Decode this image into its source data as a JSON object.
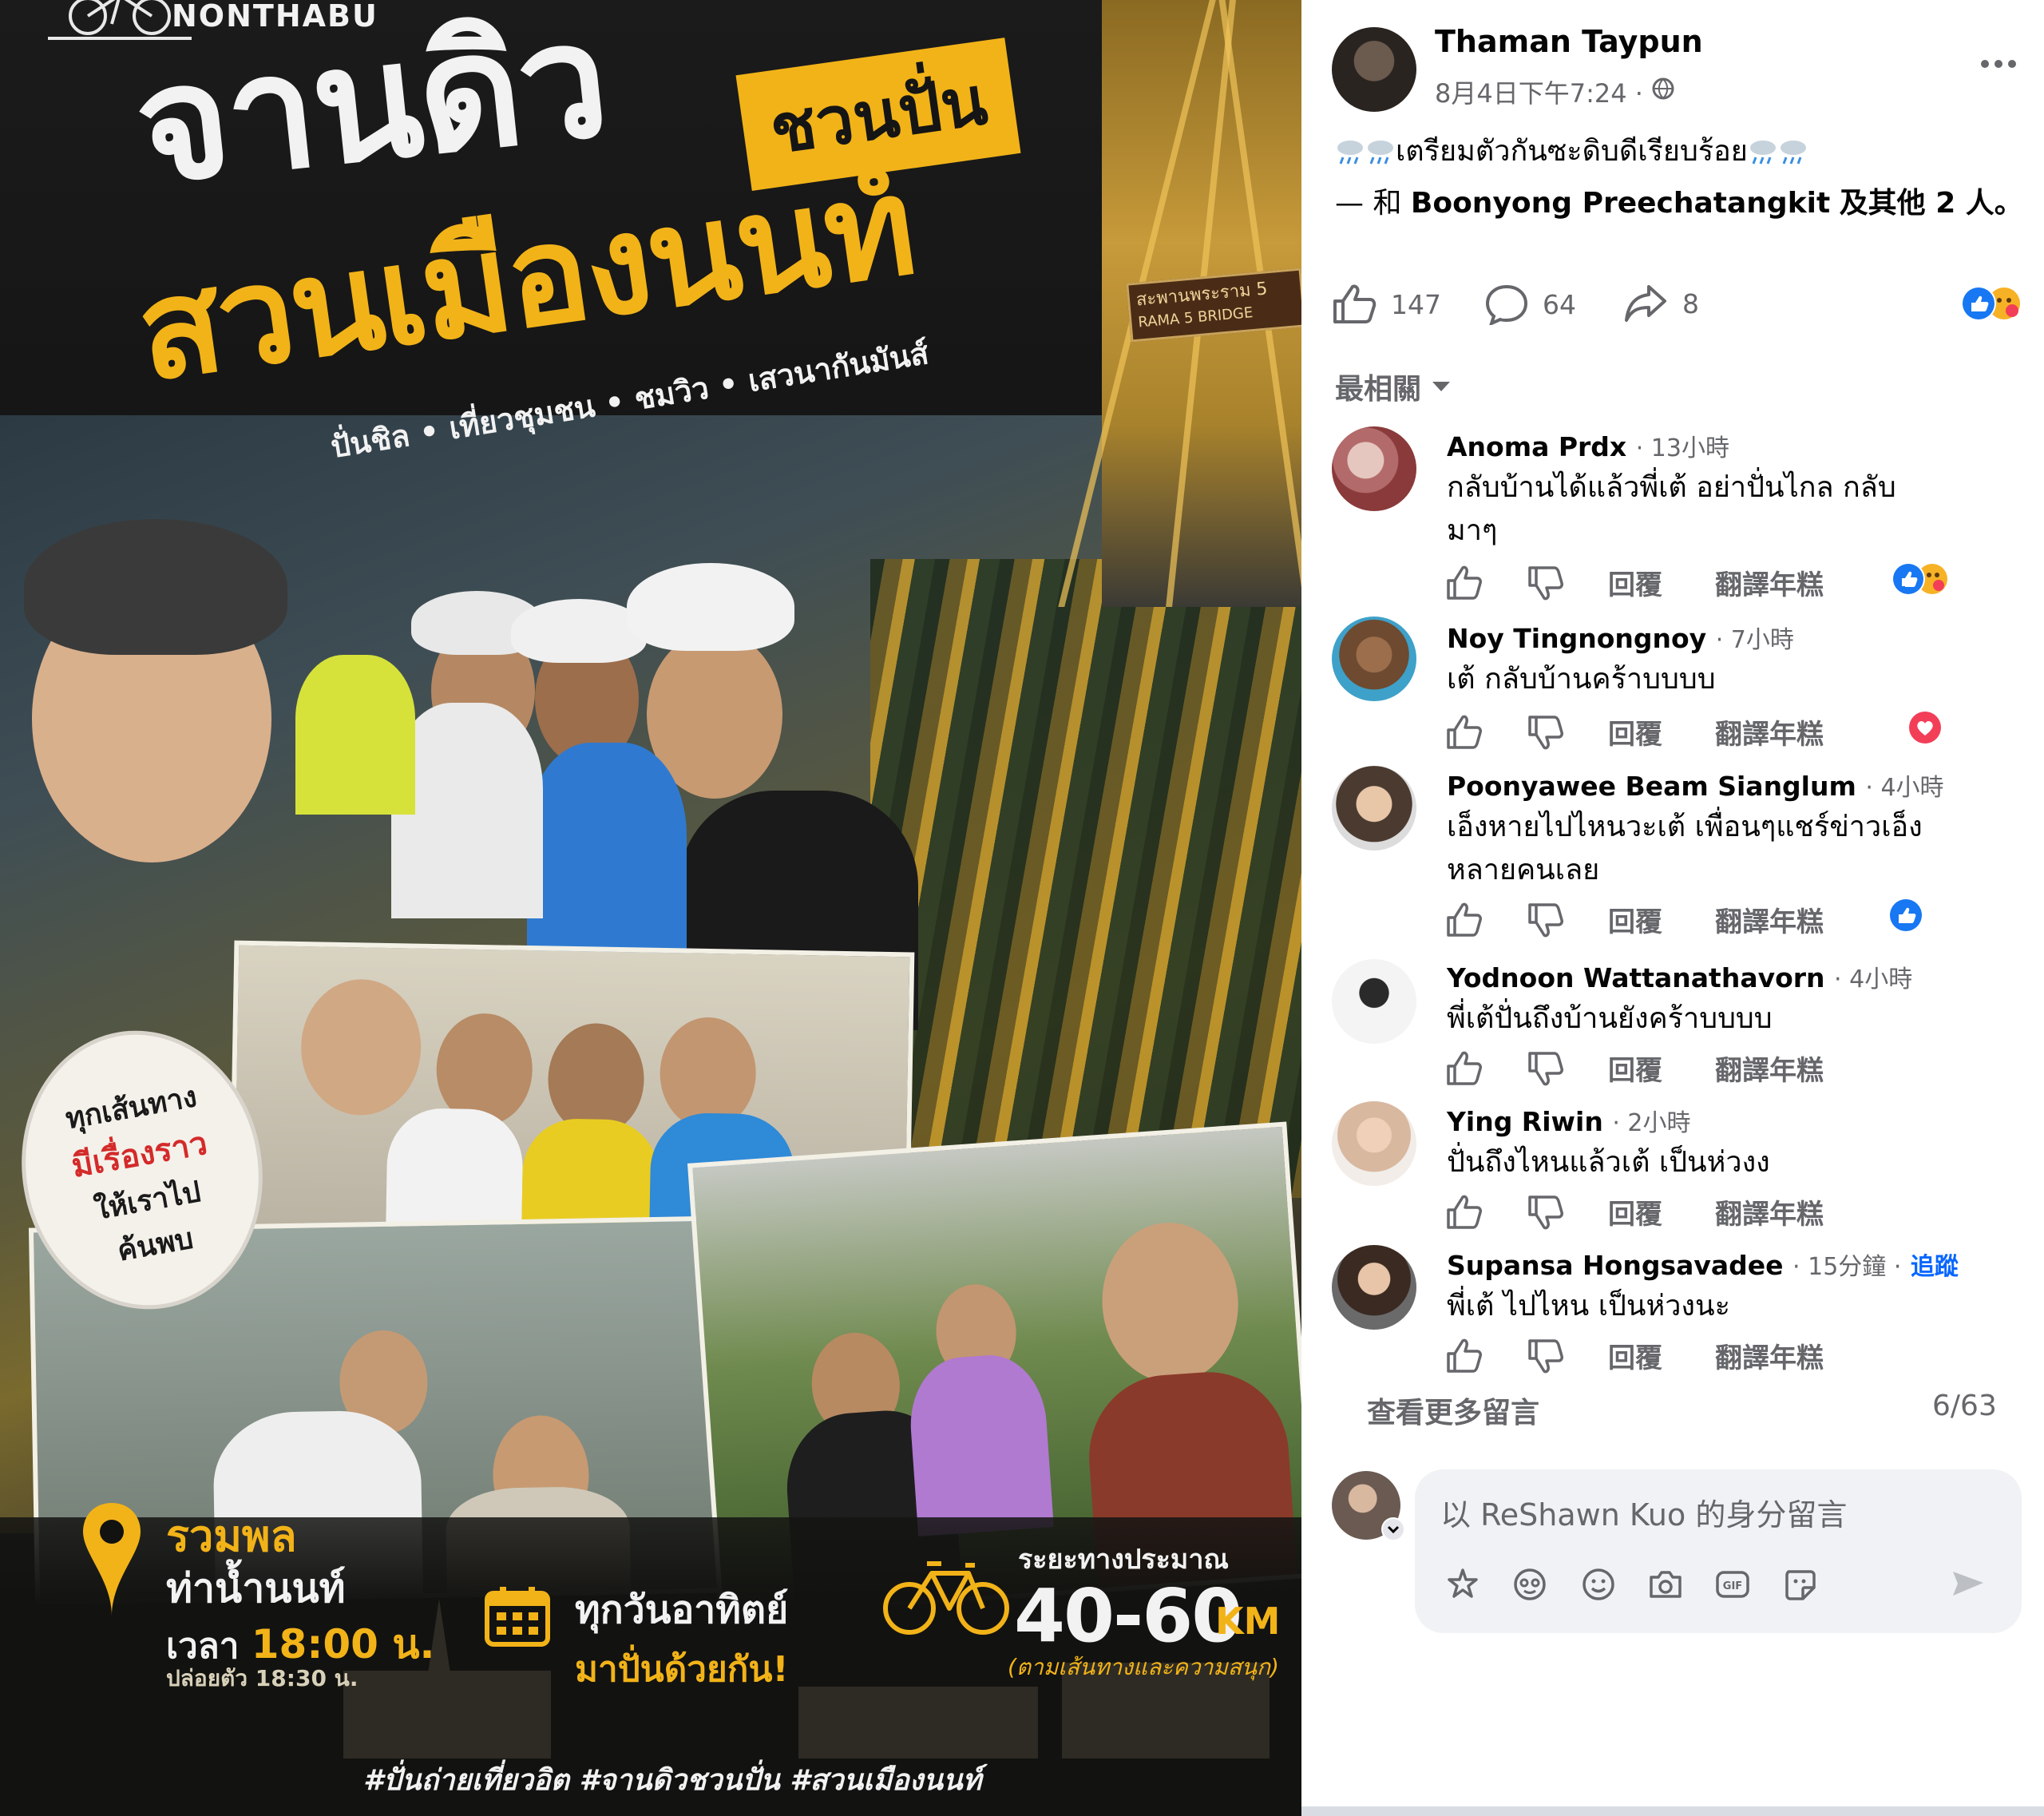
{
  "poster": {
    "brand": "NONTHABU",
    "title_line1": "จานดิว",
    "title_tag": "ชวนปั่น",
    "title_line2": "สวนเมืองนนท์",
    "subtitle": "ปั่นชิล • เที่ยวชุมชน • ชมวิว • เสวนากันมันส์",
    "bridge_sign_line1": "สะพานพระราม 5",
    "bridge_sign_line2": "RAMA 5 BRIDGE",
    "badge_line1": "ทุกเส้นทาง",
    "badge_line2": "มีเรื่องราว",
    "badge_line3": "ให้เราไป",
    "badge_line4": "ค้นพบ",
    "gather_title": "รวมพล",
    "gather_place": "ท่าน้ำนนท์",
    "gather_time_prefix": "เวลา",
    "gather_time_value": "18:00 น.",
    "gather_depart": "ปล่อยตัว 18:30 น.",
    "day_title": "ทุกวันอาทิตย์",
    "day_sub": "มาปั่นด้วยกัน!",
    "distance_label": "ระยะทางประมาณ",
    "distance_value": "40-60",
    "distance_unit": "KM",
    "distance_note": "(ตามเส้นทางและความสนุก)",
    "hashtags": "#ปั่นถ่ายเที่ยวอิต #จานดิวชวนปั่น #สวนเมืองนนท์",
    "accent_color": "#f2b318"
  },
  "post": {
    "author": "Thaman Taypun",
    "time": "8月4日下午7:24 ·",
    "text": "เตรียมตัวกันซะดิบดีเรียบร้อย",
    "tag_prefix": "— 和",
    "tag_person": "Boonyong Preechatangkit",
    "tag_suffix": "及其他 2 人。",
    "likes": "147",
    "comments": "64",
    "shares": "8",
    "sort_label": "最相關"
  },
  "comment_actions": {
    "reply": "回覆",
    "translate": "翻譯年糕"
  },
  "comments": [
    {
      "name": "Anoma Prdx",
      "time": "· 13小時",
      "text": "กลับบ้านได้แล้วพี่เต้ อย่าปั่นไกล กลับมาๆ"
    },
    {
      "name": "Noy Tingnongnoy",
      "time": "· 7小時",
      "text": "เต้ กลับบ้านคร้าบบบบ"
    },
    {
      "name": "Poonyawee Beam Sianglum",
      "time": "· 4小時",
      "text": "เอ็งหายไปไหนวะเต้ เพื่อนๆแชร์ข่าวเอ็งหลายคนเลย"
    },
    {
      "name": "Yodnoon Wattanathavorn",
      "time": "· 4小時",
      "text": "พี่เต้ปั่นถึงบ้านยังคร้าบบบบ"
    },
    {
      "name": "Ying Riwin",
      "time": "· 2小時",
      "text": "ปั่นถึงไหนแล้วเต้ เป็นห่วงง"
    },
    {
      "name": "Supansa Hongsavadee",
      "time": "· 15分鐘 ·",
      "follow": "追蹤",
      "text": "พี่เต้ ไปไหน เป็นห่วงนะ"
    }
  ],
  "more_comments": "查看更多留言",
  "comment_count": "6/63",
  "composer_placeholder": "以 ReShawn Kuo 的身分留言"
}
